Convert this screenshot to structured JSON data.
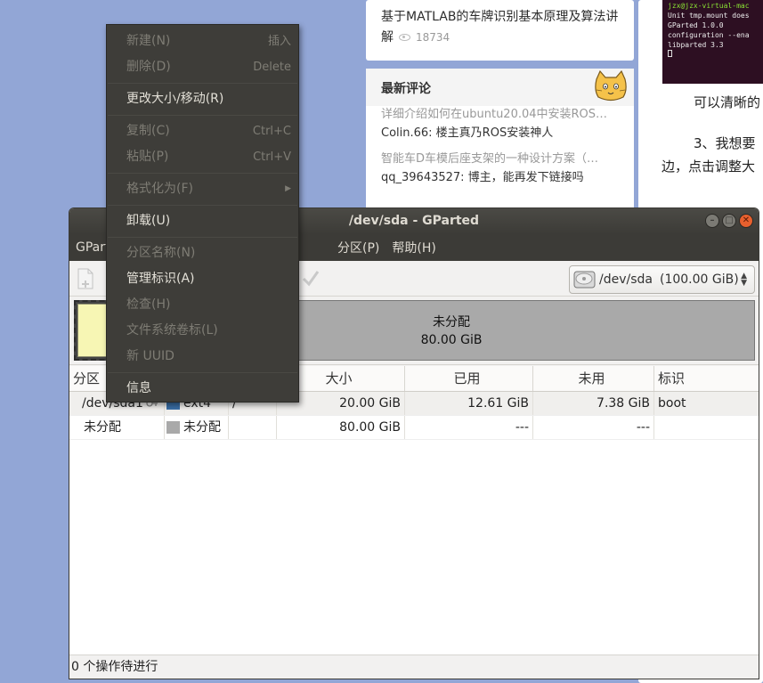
{
  "webpage": {
    "article_title": "基于MATLAB的车牌识别基本原理及算法讲解",
    "article_views": "18734",
    "comments_header": "最新评论",
    "comments": [
      {
        "title": "详细介绍如何在ubuntu20.04中安装ROS…",
        "body": "Colin.66: 楼主真乃ROS安装神人"
      },
      {
        "title": "智能车D车模后座支架的一种设计方案（…",
        "body": "qq_39643527: 博主，能再发下链接吗"
      }
    ],
    "terminal_lines": [
      "jzx@jzx-virtual-mac",
      "Unit tmp.mount does",
      "GParted 1.0.0",
      "configuration --ena",
      "libparted 3.3"
    ],
    "right_text1": "可以清晰的",
    "right_text2": "3、我想要",
    "right_text3": "边，点击调整大"
  },
  "window": {
    "title": "/dev/sda - GParted",
    "menus": {
      "gparted": "GParted",
      "partition": "分区(P)",
      "help": "帮助(H)"
    },
    "device": {
      "name": "/dev/sda",
      "size": "(100.00 GiB)"
    },
    "diskmap": {
      "unallocated_label": "未分配",
      "unallocated_size": "80.00 GiB"
    },
    "table": {
      "headers": {
        "partition": "分区",
        "size": "大小",
        "used": "已用",
        "unused": "未用",
        "label": "标识"
      },
      "rows": [
        {
          "partition": "/dev/sda1",
          "fs": "ext4",
          "mount": "/",
          "size": "20.00 GiB",
          "used": "12.61 GiB",
          "unused": "7.38 GiB",
          "label": "boot",
          "color": "#3a6ea5"
        },
        {
          "partition": "未分配",
          "fs": "未分配",
          "mount": "",
          "size": "80.00 GiB",
          "used": "---",
          "unused": "---",
          "label": "",
          "color": "#a9a9a9"
        }
      ]
    },
    "status": "0 个操作待进行"
  },
  "context_menu": {
    "new": {
      "label": "新建(N)",
      "accel": "插入"
    },
    "delete": {
      "label": "删除(D)",
      "accel": "Delete"
    },
    "resize": {
      "label": "更改大小/移动(R)"
    },
    "copy": {
      "label": "复制(C)",
      "accel": "Ctrl+C"
    },
    "paste": {
      "label": "粘贴(P)",
      "accel": "Ctrl+V"
    },
    "format": {
      "label": "格式化为(F)"
    },
    "unmount": {
      "label": "卸载(U)"
    },
    "name": {
      "label": "分区名称(N)"
    },
    "flags": {
      "label": "管理标识(A)"
    },
    "check": {
      "label": "检查(H)"
    },
    "fslabel": {
      "label": "文件系统卷标(L)"
    },
    "uuid": {
      "label": "新 UUID"
    },
    "info": {
      "label": "信息"
    }
  }
}
